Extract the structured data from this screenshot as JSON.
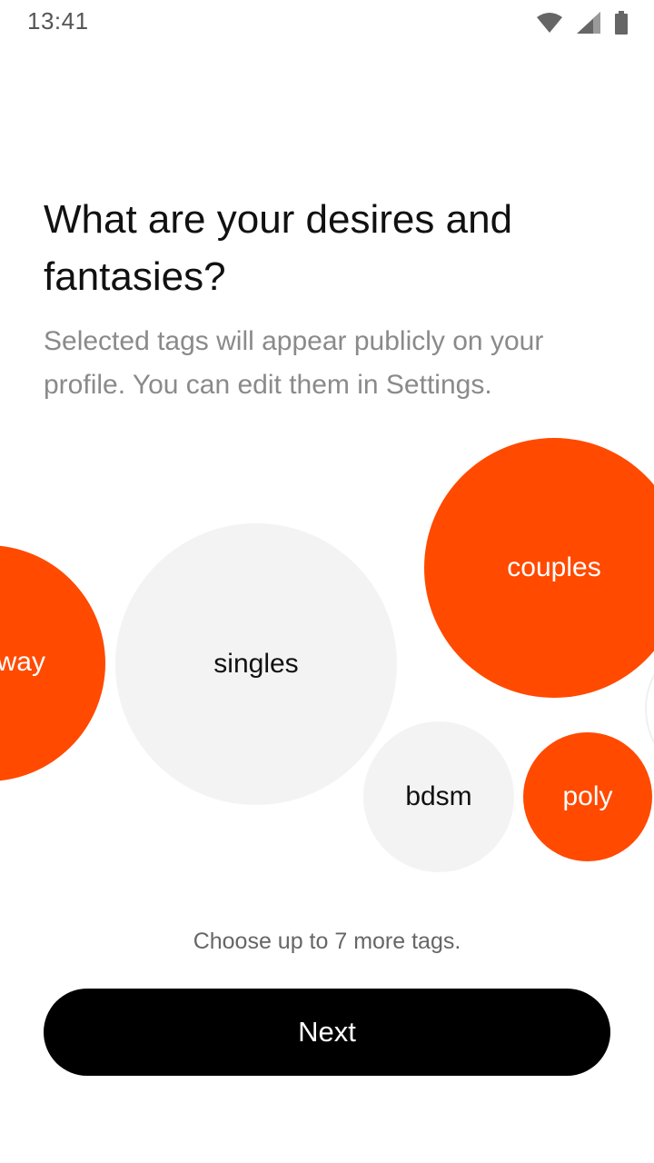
{
  "status_bar": {
    "time": "13:41",
    "icons": [
      "wifi-icon",
      "cell-signal-icon",
      "battery-icon"
    ]
  },
  "header": {
    "title": "What are your desires and fantasies?",
    "subtitle": "Selected tags will appear publicly on your profile. You can edit them in Settings."
  },
  "tags": [
    {
      "label": "way",
      "selected": true
    },
    {
      "label": "singles",
      "selected": false
    },
    {
      "label": "couples",
      "selected": true
    },
    {
      "label": "bdsm",
      "selected": false
    },
    {
      "label": "poly",
      "selected": true
    }
  ],
  "footer": {
    "hint": "Choose up to 7 more tags.",
    "next_label": "Next"
  },
  "colors": {
    "accent": "#FF4A00",
    "unselected": "#F3F3F3",
    "button": "#000000",
    "subtitle": "#8A8A8A"
  }
}
